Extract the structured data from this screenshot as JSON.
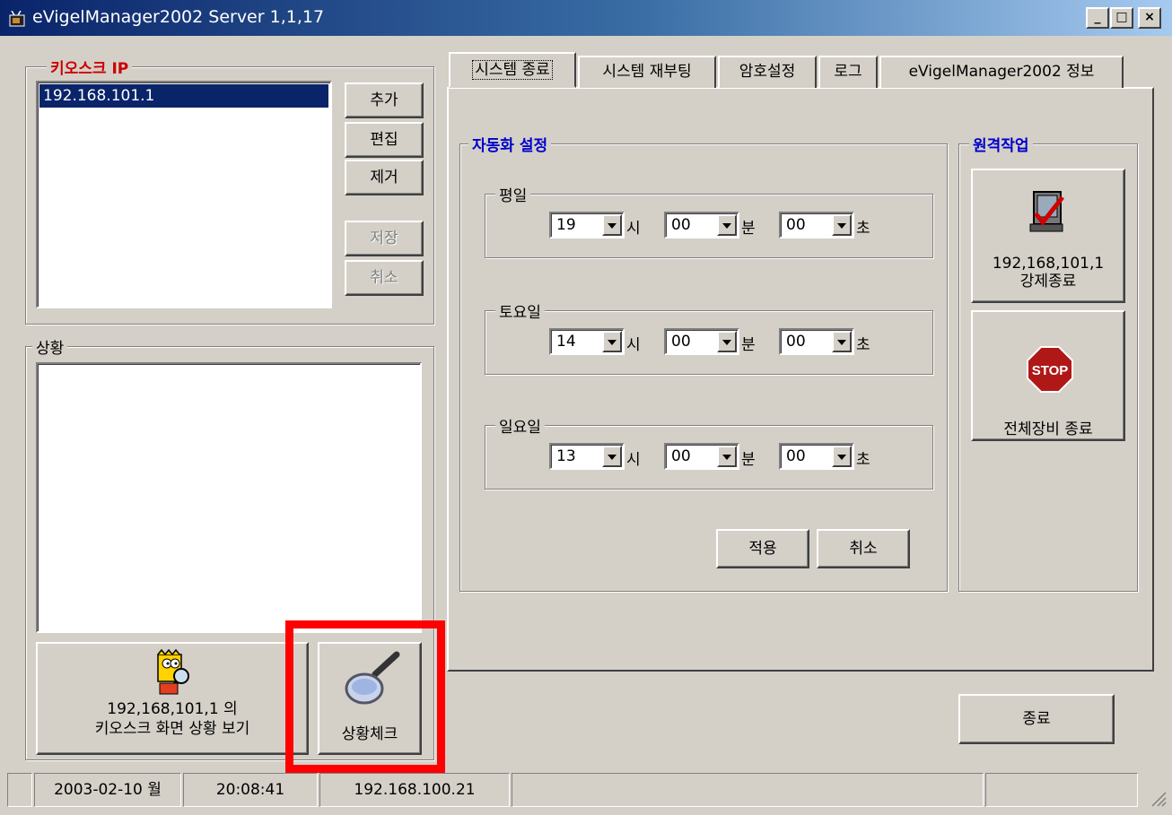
{
  "window": {
    "title": "eVigelManager2002 Server 1,1,17",
    "controls": [
      "_",
      "□",
      "×"
    ]
  },
  "kiosk": {
    "group_label": "키오스크 IP",
    "ip_list": [
      "192.168.101.1"
    ],
    "buttons": {
      "add": "추가",
      "edit": "편집",
      "remove": "제거",
      "save": "저장",
      "cancel": "취소"
    }
  },
  "status_group": {
    "label": "상황",
    "view_button": "192,168,101,1 의\n키오스크 화면 상황 보기",
    "check_button": "상황체크"
  },
  "tabs": [
    "시스템 종료",
    "시스템 재부팅",
    "암호설정",
    "로그",
    "eVigelManager2002 정보"
  ],
  "auto": {
    "label": "자동화 설정",
    "units": {
      "hour": "시",
      "minute": "분",
      "second": "초"
    },
    "rows": [
      {
        "label": "평일",
        "hour": "19",
        "minute": "00",
        "second": "00"
      },
      {
        "label": "토요일",
        "hour": "14",
        "minute": "00",
        "second": "00"
      },
      {
        "label": "일요일",
        "hour": "13",
        "minute": "00",
        "second": "00"
      }
    ],
    "apply": "적용",
    "cancel": "취소"
  },
  "remote": {
    "label": "원격작업",
    "force_shutdown": "192,168,101,1\n강제종료",
    "stop_icon_text": "STOP",
    "shutdown_all": "전체장비 종료"
  },
  "exit_button": "종료",
  "statusbar": {
    "date": "2003-02-10 월",
    "time": "20:08:41",
    "ip": "192.168.100.21"
  },
  "colors": {
    "title_gradient_start": "#0a246a",
    "group_label_red": "#cc0000",
    "group_label_blue": "#0000cc",
    "selection": "#0a246a",
    "highlight_box": "#ff0000"
  }
}
